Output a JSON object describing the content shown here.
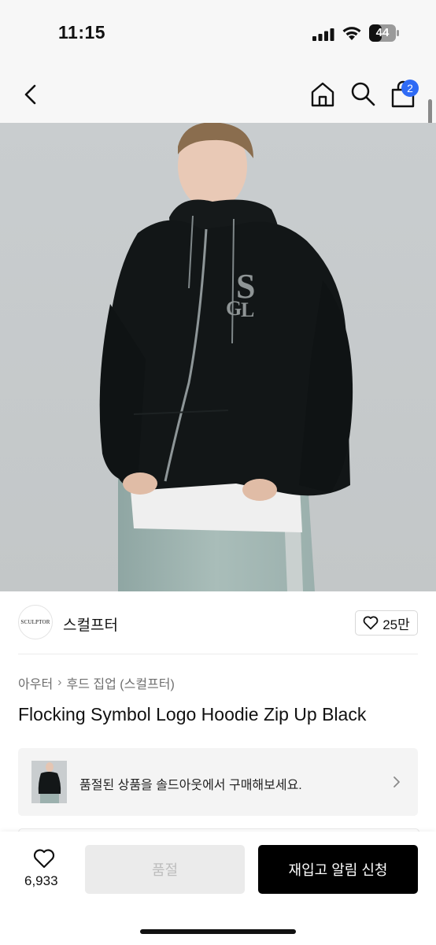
{
  "status_bar": {
    "time": "11:15",
    "battery_level": "44",
    "icons": [
      "signal-icon",
      "wifi-icon",
      "battery-icon"
    ]
  },
  "nav": {
    "icons": [
      "back-icon",
      "home-icon",
      "search-icon",
      "shopping-bag-icon"
    ],
    "cart_count": "2",
    "badge_color": "#2f6bf5"
  },
  "product": {
    "image": {
      "description_icon": "product-photo",
      "logo_letters": "SGL"
    },
    "brand": {
      "logo_text": "SCULPTOR",
      "name": "스컬프터"
    },
    "likes": "25만",
    "breadcrumb": [
      "아우터",
      "후드 집업 (스컬프터)"
    ],
    "title": "Flocking Symbol Logo Hoodie Zip Up Black"
  },
  "soldout_banner": {
    "text": "품절된 상품을 솔드아웃에서 구매해보세요."
  },
  "bottom_bar": {
    "wish_count": "6,933",
    "soldout_label": "품절",
    "restock_label": "재입고 알림 신청",
    "accent": "#000000"
  }
}
